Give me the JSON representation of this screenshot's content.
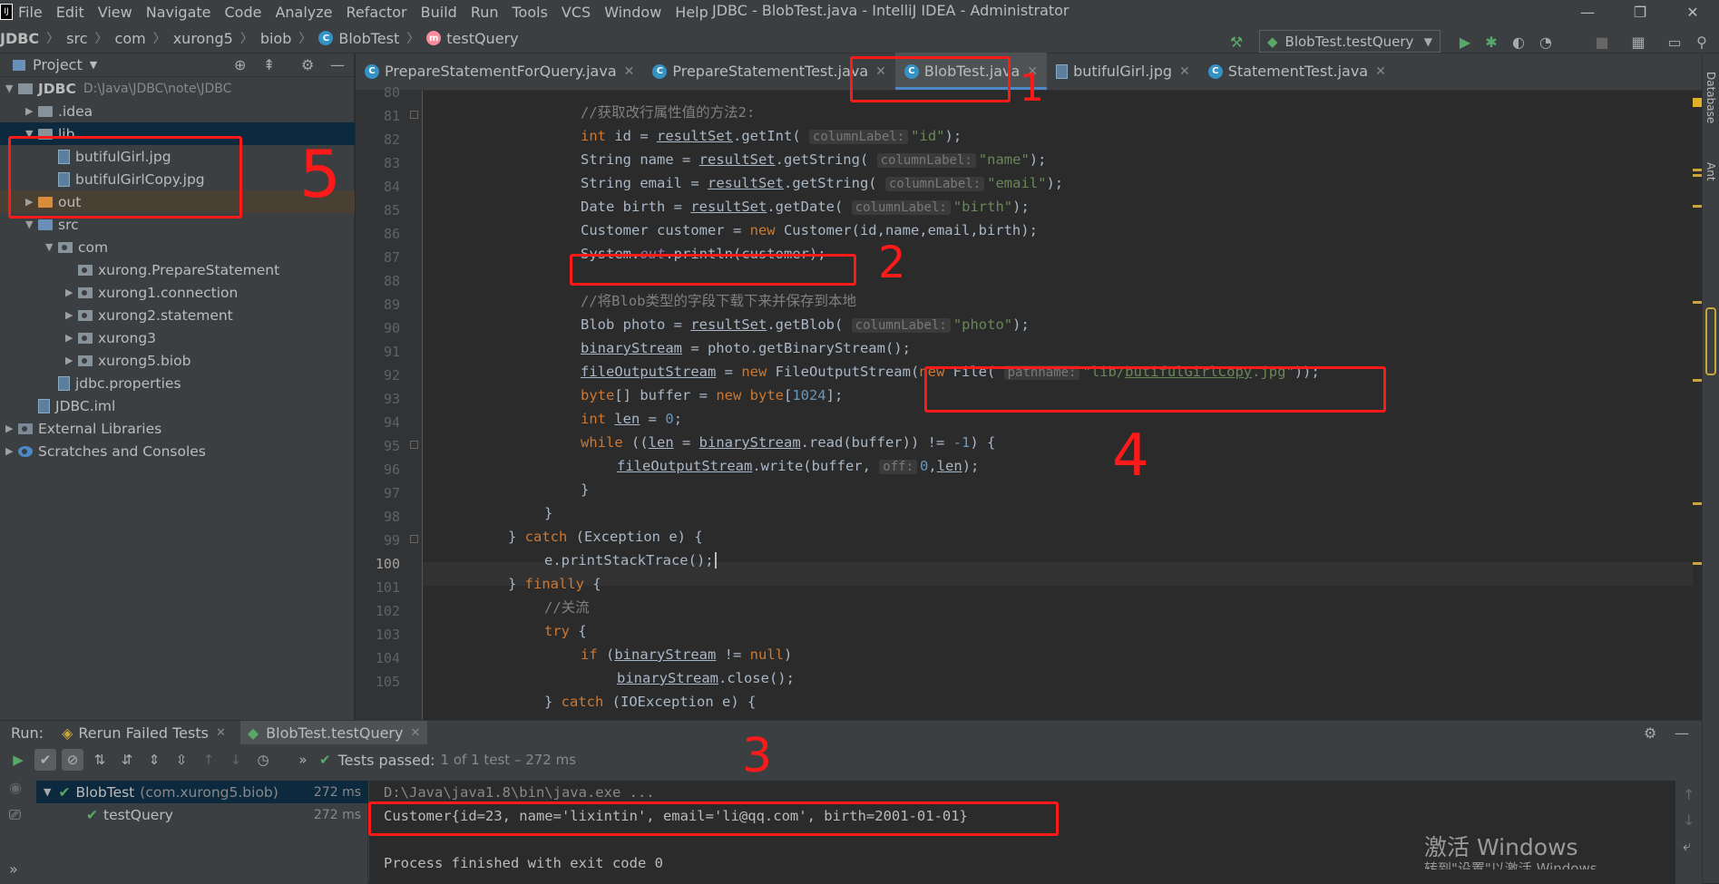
{
  "window": {
    "title": "JDBC - BlobTest.java - IntelliJ IDEA - Administrator",
    "menu": [
      "File",
      "Edit",
      "View",
      "Navigate",
      "Code",
      "Analyze",
      "Refactor",
      "Build",
      "Run",
      "Tools",
      "VCS",
      "Window",
      "Help"
    ]
  },
  "breadcrumb": [
    "JDBC",
    "src",
    "com",
    "xurong5",
    "biob",
    "BlobTest",
    "testQuery"
  ],
  "run_config": "BlobTest.testQuery",
  "project": {
    "header": "Project",
    "tree": [
      {
        "label": "JDBC",
        "path": "D:\\Java\\JDBC\\note\\JDBC",
        "depth": 0,
        "icon": "module"
      },
      {
        "label": ".idea",
        "depth": 1,
        "icon": "folder"
      },
      {
        "label": "lib",
        "depth": 1,
        "icon": "folder"
      },
      {
        "label": "butifulGirl.jpg",
        "depth": 2,
        "icon": "image-file"
      },
      {
        "label": "butifulGirlCopy.jpg",
        "depth": 2,
        "icon": "image-file"
      },
      {
        "label": "out",
        "depth": 1,
        "icon": "folder-orange"
      },
      {
        "label": "src",
        "depth": 1,
        "icon": "folder-blue"
      },
      {
        "label": "com",
        "depth": 2,
        "icon": "package"
      },
      {
        "label": "xurong.PrepareStatement",
        "depth": 3,
        "icon": "package"
      },
      {
        "label": "xurong1.connection",
        "depth": 3,
        "icon": "package"
      },
      {
        "label": "xurong2.statement",
        "depth": 3,
        "icon": "package"
      },
      {
        "label": "xurong3",
        "depth": 3,
        "icon": "package"
      },
      {
        "label": "xurong5.biob",
        "depth": 3,
        "icon": "package"
      },
      {
        "label": "jdbc.properties",
        "depth": 2,
        "icon": "properties-file"
      },
      {
        "label": "JDBC.iml",
        "depth": 1,
        "icon": "iml-file"
      },
      {
        "label": "External Libraries",
        "depth": 0,
        "icon": "library"
      },
      {
        "label": "Scratches and Consoles",
        "depth": 0,
        "icon": "scratches"
      }
    ]
  },
  "tabs": [
    {
      "label": "PrepareStatementForQuery.java",
      "active": false
    },
    {
      "label": "PrepareStatementTest.java",
      "active": false
    },
    {
      "label": "BlobTest.java",
      "active": true
    },
    {
      "label": "butifulGirl.jpg",
      "active": false
    },
    {
      "label": "StatementTest.java",
      "active": false
    }
  ],
  "line_numbers": [
    "80",
    "81",
    "82",
    "83",
    "84",
    "85",
    "86",
    "87",
    "88",
    "89",
    "90",
    "91",
    "92",
    "93",
    "94",
    "95",
    "96",
    "97",
    "98",
    "99",
    "100",
    "101",
    "102",
    "103",
    "104",
    "105"
  ],
  "code_text": {
    "l81": "//获取改行属性值的方法2:",
    "l89": "//将Blob类型的字段下载下来并保存到本地",
    "l102": "//关流",
    "hint_columnLabel": "columnLabel:",
    "hint_pathname": "pathname:",
    "hint_off": "off:",
    "s_id": "\"id\"",
    "s_name": "\"name\"",
    "s_email": "\"email\"",
    "s_birth": "\"birth\"",
    "s_photo": "\"photo\"",
    "s_path_a": "\"lib/",
    "s_path_b": "butifulGirlCopy",
    "s_path_c": ".jpg\"",
    "n_1024": "1024",
    "n_0": "0",
    "n_m1": "-1"
  },
  "run": {
    "label": "Run:",
    "tabs": [
      "Rerun Failed Tests",
      "BlobTest.testQuery"
    ],
    "status": "Tests passed:",
    "status_detail": "1 of 1 test – 272 ms",
    "tree": [
      {
        "label": "BlobTest",
        "detail": "(com.xurong5.biob)",
        "time": "272 ms"
      },
      {
        "label": "testQuery",
        "detail": "",
        "time": "272 ms"
      }
    ],
    "console": [
      "D:\\Java\\java1.8\\bin\\java.exe ...",
      "Customer{id=23, name='lixintin', email='li@qq.com', birth=2001-01-01}",
      "",
      "Process finished with exit code 0"
    ]
  },
  "right_bar": [
    "Database",
    "Ant"
  ],
  "watermark": "激活 Windows",
  "watermark_sub": "转到\"设置\"以激活 Windows。",
  "annotations": [
    "1",
    "2",
    "3",
    "4",
    "5"
  ],
  "colors": {
    "annotation": "#ff1a1a",
    "accent": "#4a88c7",
    "keyword": "#cc7832",
    "string": "#6a8759",
    "number": "#6897bb"
  }
}
